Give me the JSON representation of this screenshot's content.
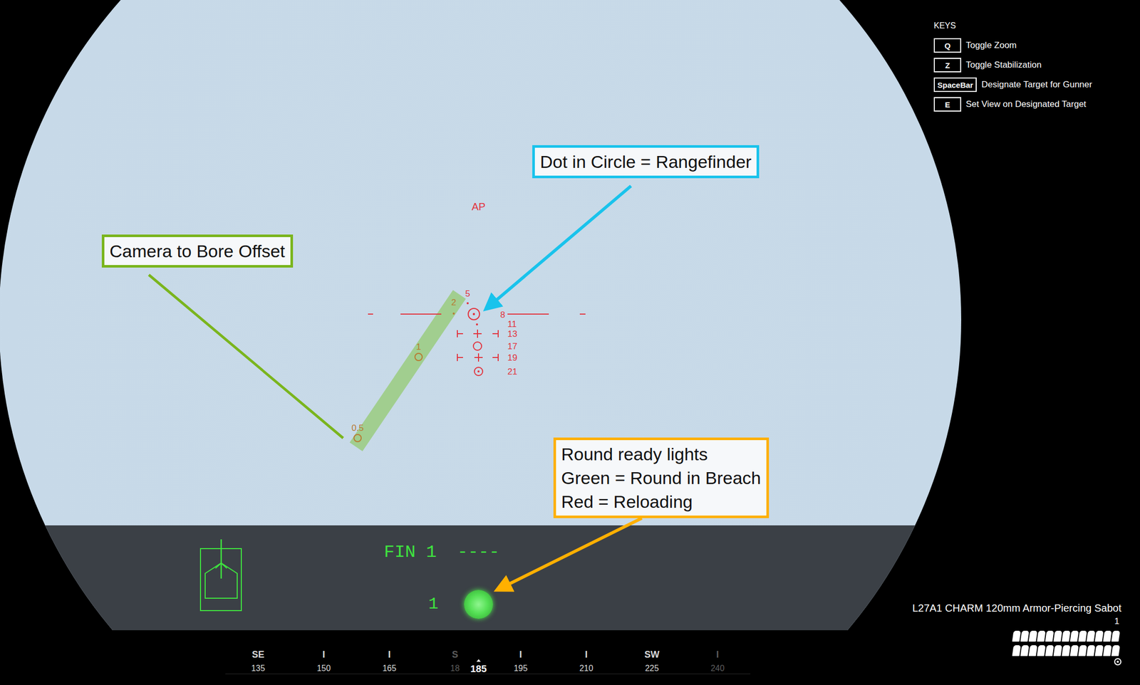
{
  "keys": {
    "title": "KEYS",
    "items": [
      {
        "key": "Q",
        "label": "Toggle Zoom"
      },
      {
        "key": "Z",
        "label": "Toggle Stabilization"
      },
      {
        "key": "SpaceBar",
        "label": "Designate Target for Gunner"
      },
      {
        "key": "E",
        "label": "Set View on Designated Target"
      }
    ]
  },
  "annotations": [
    {
      "lines": [
        "Camera to Bore Offset"
      ],
      "color": "#7ab51d"
    },
    {
      "lines": [
        "Dot in Circle = Rangefinder"
      ],
      "color": "#19c3ec"
    },
    {
      "lines": [
        "Round ready lights",
        "Green = Round in Breach",
        "Red = Reloading"
      ],
      "color": "#ffb000"
    }
  ],
  "reticle": {
    "ammo_type": "AP",
    "range_marks": [
      "5",
      "8",
      "11",
      "13",
      "17",
      "19",
      "21"
    ],
    "bore_offset_marks": [
      "2",
      "1",
      "0.5"
    ]
  },
  "ammo_readout": {
    "ammo": "FIN 1",
    "range": "----",
    "count": "1",
    "round_ready": true
  },
  "magazine": {
    "name": "L27A1 CHARM 120mm Armor-Piercing Sabot",
    "count": "1",
    "rounds_shown": 26
  },
  "compass": {
    "marks": [
      {
        "label": "SE",
        "value": "135",
        "faded": false
      },
      {
        "label": "I",
        "value": "150",
        "faded": false
      },
      {
        "label": "I",
        "value": "165",
        "faded": false
      },
      {
        "label": "S",
        "value": "18",
        "faded": true
      },
      {
        "label": "I",
        "value": "195",
        "faded": false
      },
      {
        "label": "I",
        "value": "210",
        "faded": false
      },
      {
        "label": "SW",
        "value": "225",
        "faded": false
      },
      {
        "label": "I",
        "value": "240",
        "faded": true
      }
    ],
    "heading": "185"
  }
}
